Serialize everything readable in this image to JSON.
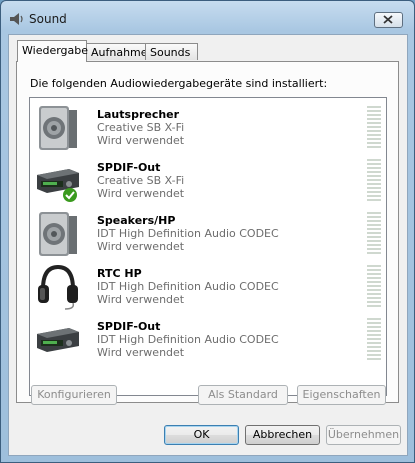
{
  "window": {
    "title": "Sound"
  },
  "tabs": [
    {
      "label": "Wiedergabe",
      "active": true
    },
    {
      "label": "Aufnahme",
      "active": false
    },
    {
      "label": "Sounds",
      "active": false
    }
  ],
  "panel": {
    "caption": "Die folgenden Audiowiedergabegeräte sind installiert:"
  },
  "devices": [
    {
      "name": "Lautsprecher",
      "description": "Creative SB X-Fi",
      "status": "Wird verwendet",
      "icon": "speaker-icon",
      "default": false
    },
    {
      "name": "SPDIF-Out",
      "description": "Creative SB X-Fi",
      "status": "Wird verwendet",
      "icon": "digital-output-icon",
      "default": true
    },
    {
      "name": "Speakers/HP",
      "description": "IDT High Definition Audio CODEC",
      "status": "Wird verwendet",
      "icon": "speaker-icon",
      "default": false
    },
    {
      "name": "RTC HP",
      "description": "IDT High Definition Audio CODEC",
      "status": "Wird verwendet",
      "icon": "headphones-icon",
      "default": false
    },
    {
      "name": "SPDIF-Out",
      "description": "IDT High Definition Audio CODEC",
      "status": "Wird verwendet",
      "icon": "digital-output-icon",
      "default": false
    }
  ],
  "panel_buttons": {
    "configure": "Konfigurieren",
    "set_default": "Als Standard",
    "properties": "Eigenschaften"
  },
  "dialog_buttons": {
    "ok": "OK",
    "cancel": "Abbrechen",
    "apply": "Übernehmen"
  },
  "colors": {
    "accent": "#3c7fb1",
    "default_check": "#3a9a1e",
    "meter_idle": "#cfd8cf"
  }
}
